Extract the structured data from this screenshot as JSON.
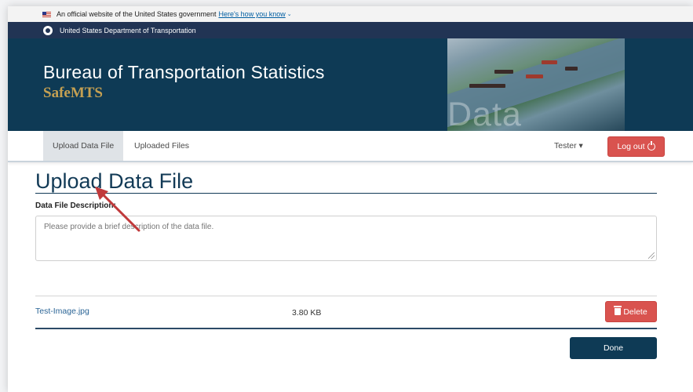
{
  "gov_banner": {
    "text": "An official website of the United States government",
    "link": "Here's how you know",
    "chevron": "⌄"
  },
  "agency": {
    "name": "United States Department of Transportation"
  },
  "hero": {
    "title": "Bureau of Transportation Statistics",
    "subtitle": "SafeMTS",
    "photo_overlay": "Data Portal"
  },
  "nav": {
    "tabs": [
      {
        "label": "Upload Data File",
        "active": true
      },
      {
        "label": "Uploaded Files",
        "active": false
      }
    ],
    "user": "Tester",
    "user_caret": "▾",
    "logout_label": "Log out"
  },
  "main": {
    "title": "Upload Data File",
    "description_label": "Data File Description:",
    "description_placeholder": "Please provide a brief description of the data file.",
    "file": {
      "name": "Test-Image.jpg",
      "size": "3.80 KB",
      "delete_label": "Delete"
    },
    "done_label": "Done"
  },
  "colors": {
    "navy": "#0e3a55",
    "danger": "#d9534f",
    "gold": "#c4a052",
    "annotation_arrow": "#c0393b"
  },
  "icons": [
    "us-flag-icon",
    "dot-logo-icon",
    "power-icon",
    "trash-icon",
    "chevron-down-icon",
    "resize-grip-icon"
  ]
}
